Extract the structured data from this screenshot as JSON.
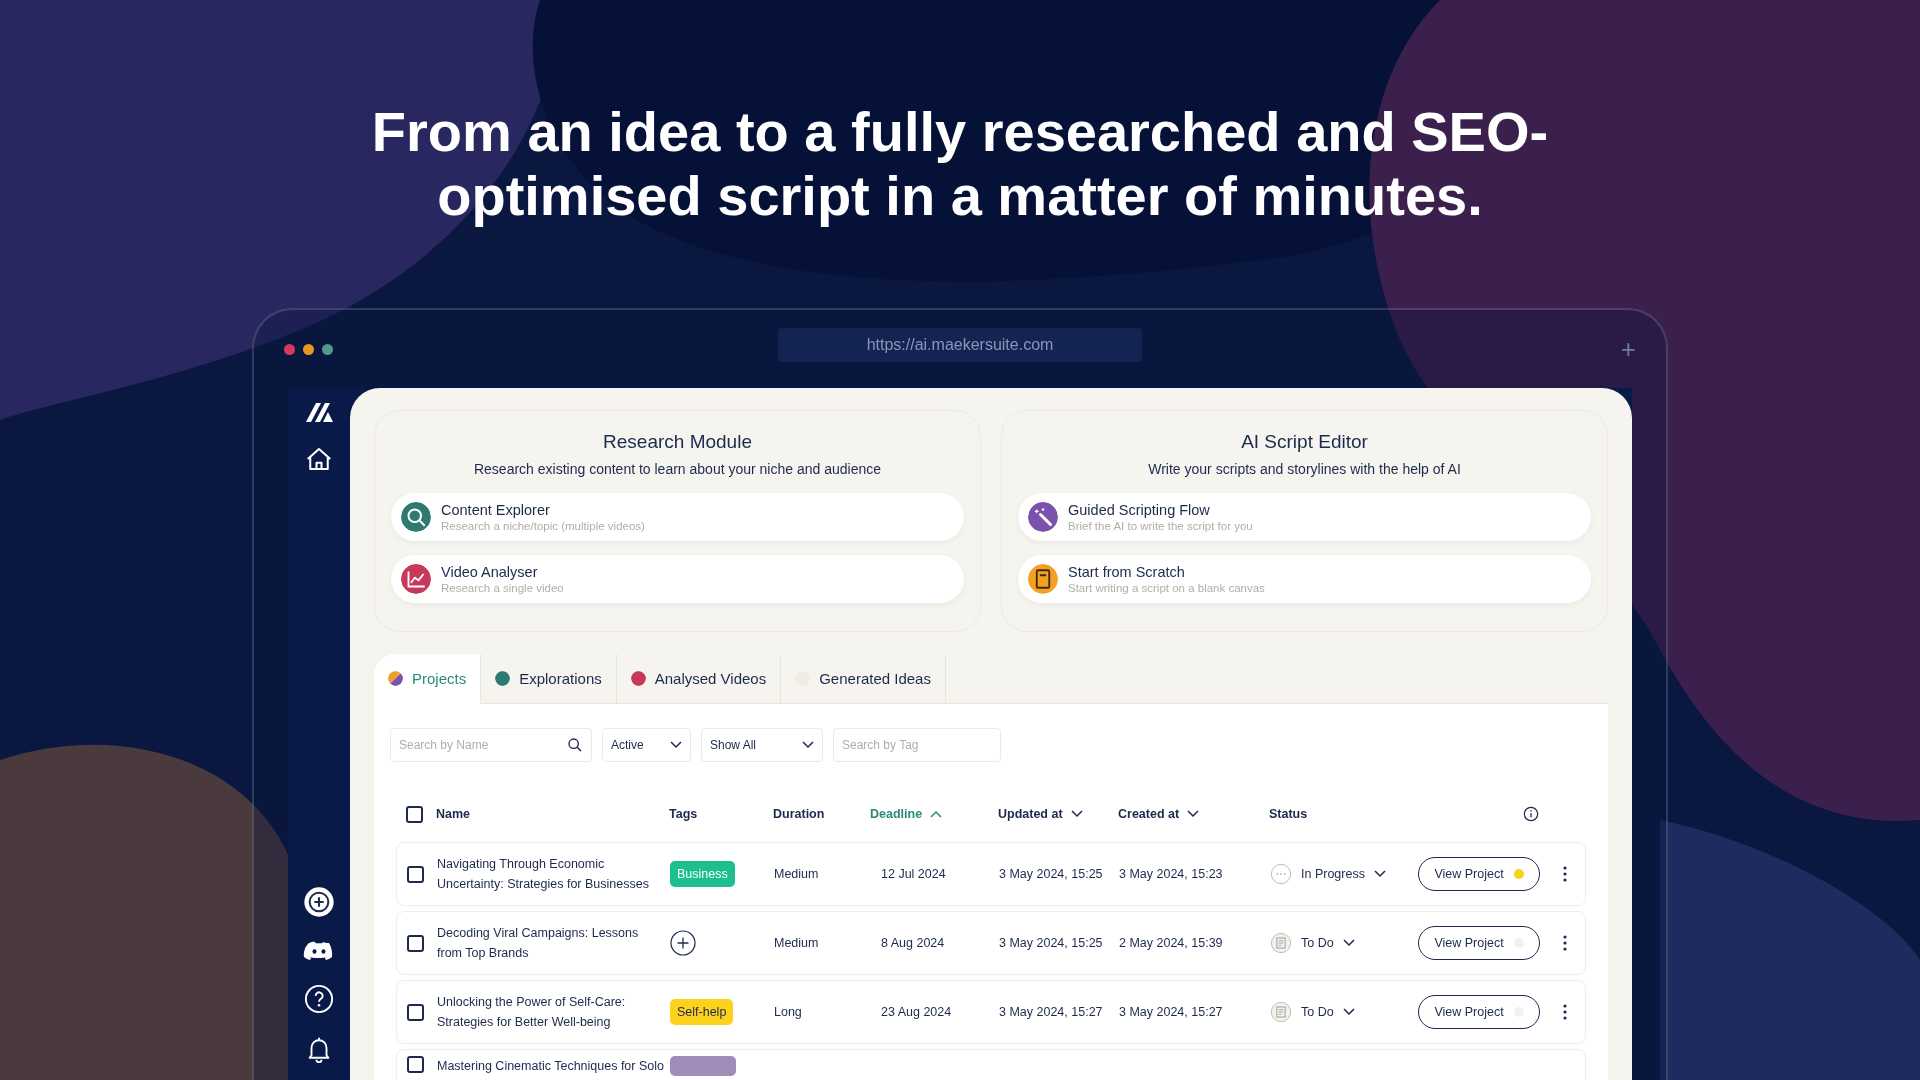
{
  "headline": "From an idea to a fully researched and SEO-optimised script in a matter of minutes.",
  "browser": {
    "url": "https://ai.maekersuite.com",
    "new_tab": "+"
  },
  "modules": [
    {
      "title": "Research Module",
      "subtitle": "Research existing content to learn about your niche and audience",
      "actions": [
        {
          "kind": "search",
          "title": "Content Explorer",
          "subtitle": "Research a niche/topic (multiple videos)",
          "color": "#2f7a70"
        },
        {
          "kind": "chart",
          "title": "Video Analyser",
          "subtitle": "Research a single video",
          "color": "#c8385a"
        }
      ]
    },
    {
      "title": "AI Script Editor",
      "subtitle": "Write your scripts and storylines with the help of AI",
      "actions": [
        {
          "kind": "wand",
          "title": "Guided Scripting Flow",
          "subtitle": "Brief the AI to write the script for you",
          "color": "#7b52ab"
        },
        {
          "kind": "document",
          "title": "Start from Scratch",
          "subtitle": "Start writing a script on a blank canvas",
          "color": "#f5a020"
        }
      ]
    }
  ],
  "tabs": [
    {
      "label": "Projects",
      "selected": true,
      "dot": [
        {
          "color": "#f0a030"
        },
        {
          "color": "#7b52ab"
        }
      ]
    },
    {
      "label": "Explorations",
      "selected": false,
      "dot": [
        {
          "color": "#2f7a70"
        }
      ]
    },
    {
      "label": "Analysed Videos",
      "selected": false,
      "dot": [
        {
          "color": "#c8385a"
        }
      ]
    },
    {
      "label": "Generated Ideas",
      "selected": false,
      "dot": [
        {
          "color": "#efece2"
        }
      ]
    }
  ],
  "filters": {
    "name_search": {
      "placeholder": "Search by Name"
    },
    "status": "Active",
    "visibility": "Show All",
    "tag_search": {
      "placeholder": "Search by Tag"
    }
  },
  "table": {
    "select_all": {
      "checked": false
    },
    "columns": [
      {
        "label": "Name",
        "selected": false
      },
      {
        "label": "Tags",
        "selected": false
      },
      {
        "label": "Duration",
        "selected": false
      },
      {
        "label": "Deadline",
        "selected": true,
        "sorted_ascending": true
      },
      {
        "label": "Updated at",
        "selected": false,
        "sorted_ascending": false
      },
      {
        "label": "Created at",
        "selected": false,
        "sorted_ascending": false
      },
      {
        "label": "Status",
        "selected": false
      }
    ],
    "rows": [
      {
        "name": "Navigating Through Economic Uncertainty: Strategies for Businesses",
        "checked": false,
        "tag": {
          "label": "Business",
          "color": "#1dbf8f"
        },
        "duration": "Medium",
        "deadline": "12 Jul 2024",
        "updated": "3 May 2024, 15:25",
        "created": "3 May 2024, 15:23",
        "status": {
          "kind": "in_progress",
          "label": "In Progress"
        },
        "action": "View Project",
        "color": "#f8d21c"
      },
      {
        "name": "Decoding Viral Campaigns: Lessons from Top Brands",
        "checked": false,
        "duration": "Medium",
        "deadline": "8 Aug 2024",
        "updated": "3 May 2024, 15:25",
        "created": "2 May 2024, 15:39",
        "status": {
          "kind": "todo",
          "label": "To Do"
        },
        "action": "View Project",
        "color": "#f3f2ee"
      },
      {
        "name": "Unlocking the Power of Self-Care: Strategies for Better Well-being",
        "checked": false,
        "tag": {
          "label": "Self-help",
          "color": "#fcd21d"
        },
        "duration": "Long",
        "deadline": "23 Aug 2024",
        "updated": "3 May 2024, 15:27",
        "created": "3 May 2024, 15:27",
        "status": {
          "kind": "todo",
          "label": "To Do"
        },
        "action": "View Project",
        "color": "#f3f2ee"
      },
      {
        "name": "Mastering Cinematic Techniques for Solo",
        "checked": false,
        "tag": {
          "color": "#a08cb8"
        }
      }
    ]
  }
}
